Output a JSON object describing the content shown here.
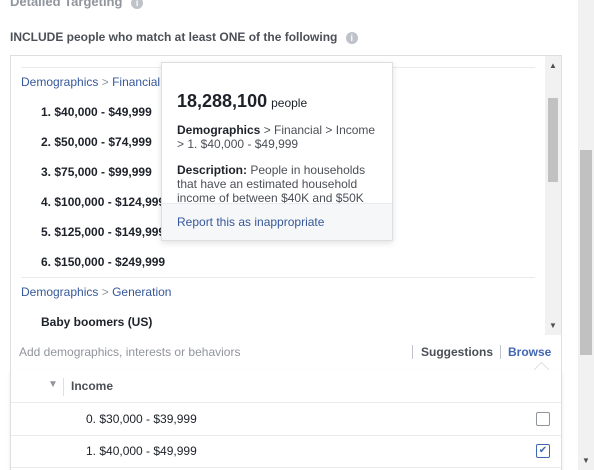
{
  "section_title": "Detailed Targeting",
  "include_label": "INCLUDE people who match at least ONE of the following",
  "selected": {
    "financial_crumb": {
      "category": "Demographics",
      "separator": ">",
      "sub": "Financial"
    },
    "income_items": [
      "1. $40,000 - $49,999",
      "2. $50,000 - $74,999",
      "3. $75,000 - $99,999",
      "4. $100,000 - $124,999",
      "5. $125,000 - $149,999",
      "6. $150,000 - $249,999"
    ],
    "generation_crumb": {
      "category": "Demographics",
      "separator": ">",
      "sub": "Generation"
    },
    "generation_items": [
      "Baby boomers (US)"
    ]
  },
  "popover": {
    "count": "18,288,100",
    "count_unit": "people",
    "path_bold": "Demographics",
    "path_rest": " > Financial > Income > 1. $40,000 - $49,999",
    "desc_label": "Description:",
    "desc_text": " People in households that have an estimated household income of between $40K and $50K",
    "report_link": "Report this as inappropriate"
  },
  "search": {
    "placeholder": "Add demographics, interests or behaviors",
    "suggestions_label": "Suggestions",
    "browse_label": "Browse"
  },
  "browse_panel": {
    "header": "Income",
    "rows": [
      {
        "label": "0. $30,000 - $39,999",
        "checked": false
      },
      {
        "label": "1. $40,000 - $49,999",
        "checked": true
      }
    ]
  },
  "colors": {
    "link": "#365899",
    "accent": "#4267b2",
    "muted": "#90949c"
  },
  "icons": {
    "info": "info-icon",
    "check": "check-icon",
    "scroll_up": "arrow-up-icon",
    "scroll_down": "arrow-down-icon",
    "collapse": "triangle-down-icon"
  }
}
